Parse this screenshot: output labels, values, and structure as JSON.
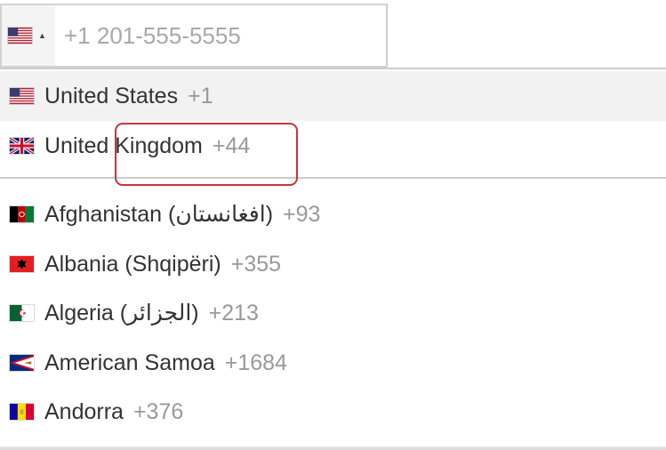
{
  "phone_input": {
    "placeholder": "+1 201-555-5555",
    "selected_flag": "us-flag-icon",
    "dropdown_arrow": "▲"
  },
  "preferred_countries": [
    {
      "name": "United States",
      "dial_code": "+1",
      "flag": "us-flag-icon",
      "highlighted": true
    },
    {
      "name": "United Kingdom",
      "dial_code": "+44",
      "flag": "uk-flag-icon",
      "highlighted": false
    }
  ],
  "countries": [
    {
      "name": "Afghanistan (‫افغانستان‬‎)",
      "dial_code": "+93",
      "flag": "af-flag-icon"
    },
    {
      "name": "Albania (Shqipëri)",
      "dial_code": "+355",
      "flag": "al-flag-icon"
    },
    {
      "name": "Algeria (‫الجزائر‬‎)",
      "dial_code": "+213",
      "flag": "dz-flag-icon"
    },
    {
      "name": "American Samoa",
      "dial_code": "+1684",
      "flag": "as-flag-icon"
    },
    {
      "name": "Andorra",
      "dial_code": "+376",
      "flag": "ad-flag-icon"
    }
  ],
  "colors": {
    "highlight_background": "#f2f2f2",
    "annotation_border": "#c9343c",
    "dial_code_text": "#999999"
  }
}
